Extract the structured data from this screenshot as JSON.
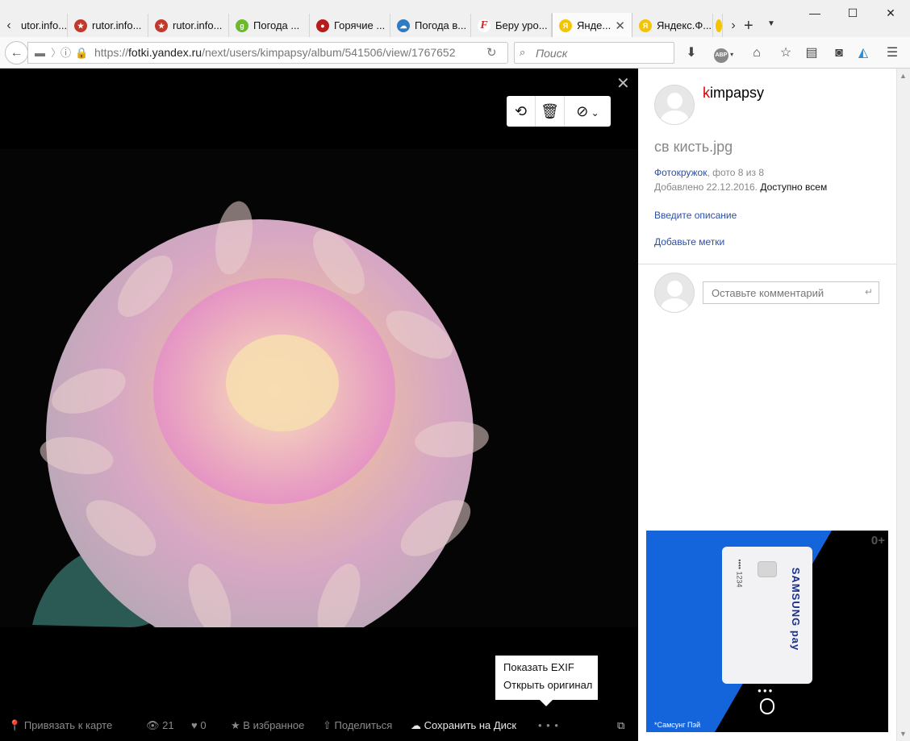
{
  "browser": {
    "tabs": [
      {
        "title": "utor.info...",
        "icon": "rutor-favicon",
        "color": "#c0392b"
      },
      {
        "title": "rutor.info...",
        "icon": "rutor-favicon",
        "color": "#c0392b"
      },
      {
        "title": "rutor.info...",
        "icon": "rutor-favicon",
        "color": "#c0392b"
      },
      {
        "title": "Погода ...",
        "icon": "gismeteo-favicon",
        "color": "#6cba2a"
      },
      {
        "title": "Горячие ...",
        "icon": "news-favicon",
        "color": "#b71c1c"
      },
      {
        "title": "Погода в...",
        "icon": "weather-favicon",
        "color": "#2d7bc4"
      },
      {
        "title": "Беру уро...",
        "icon": "f-favicon",
        "color": "#c62828"
      },
      {
        "title": "Янде...",
        "icon": "yandex-fotki-favicon",
        "color": "#f5c400"
      },
      {
        "title": "Яндекс.Ф...",
        "icon": "yandex-fotki-favicon",
        "color": "#f5c400"
      }
    ],
    "url_prefix": "https://",
    "url_host": "fotki.yandex.ru",
    "url_path": "/next/users/kimpapsy/album/541506/view/1767652",
    "search_placeholder": "Поиск",
    "window_controls": {
      "minimize": "—",
      "maximize": "☐",
      "close": "✕"
    }
  },
  "viewer": {
    "toolbar": {
      "rotate_icon": "rotate-icon",
      "delete_icon": "trash-icon",
      "block_icon": "block-icon"
    },
    "context_menu": [
      "Показать EXIF",
      "Открыть оригинал"
    ],
    "bottom": {
      "map_label": "Привязать к карте",
      "views_count": "21",
      "likes_count": "0",
      "favorites_label": "В избранное",
      "share_label": "Поделиться",
      "save_to_disk_label": "Сохранить на Диск",
      "more_label": "• • •"
    }
  },
  "panel": {
    "username_first": "k",
    "username_rest": "impapsy",
    "photo_title": "св кисть.jpg",
    "album_link": "Фотокружок",
    "album_position": ", фото 8 из 8",
    "added_label": "Добавлено 22.12.2016.",
    "visibility": "Доступно всем",
    "add_description": "Введите описание",
    "add_tags": "Добавьте метки",
    "comment_placeholder": "Оставьте комментарий",
    "ad": {
      "age_rating": "0+",
      "card_number": "•••• 1234",
      "brand": "SAMSUNG pay",
      "caption": "*Самсунг Пэй"
    }
  }
}
